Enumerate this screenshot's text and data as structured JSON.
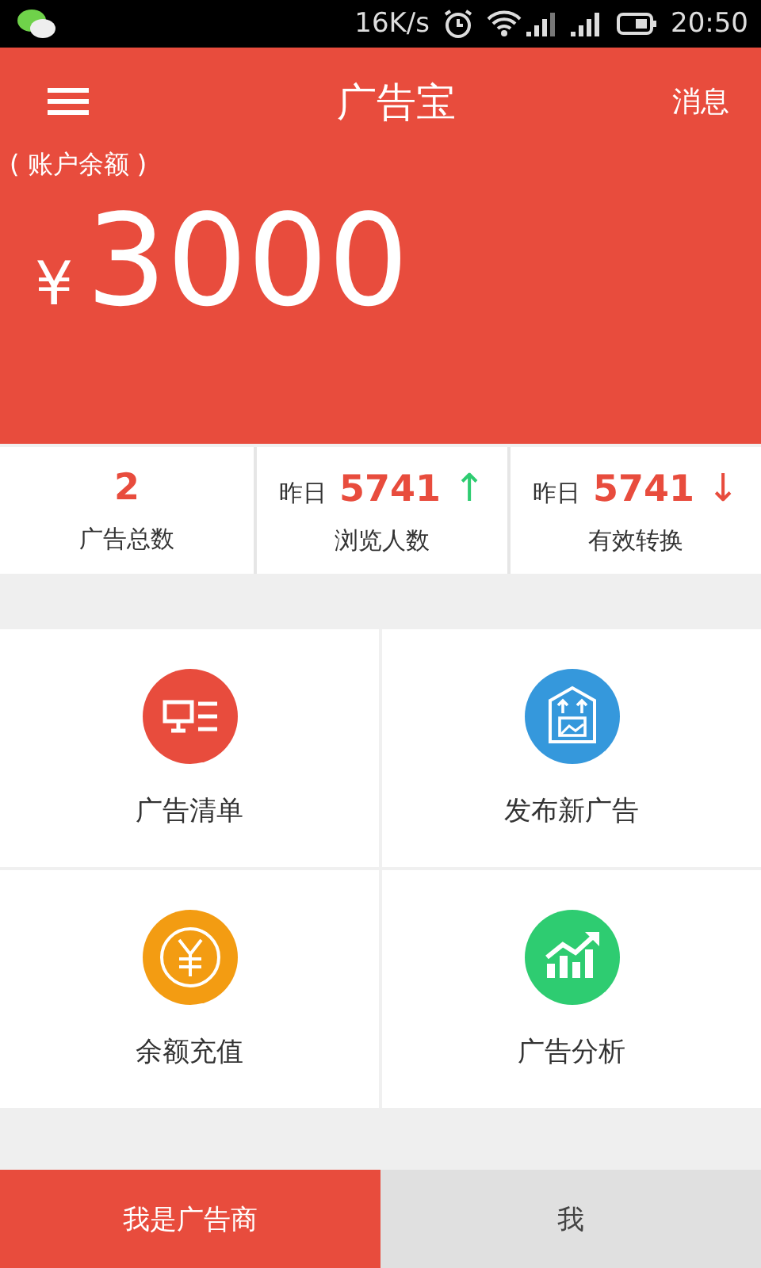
{
  "status_bar": {
    "network_speed": "16K/s",
    "time": "20:50"
  },
  "header": {
    "title": "广告宝",
    "action": "消息"
  },
  "balance": {
    "label": "( 账户余额 )",
    "currency": "¥",
    "amount": "3000"
  },
  "stats": [
    {
      "value": "2",
      "label": "广告总数"
    },
    {
      "kind": "rise",
      "prefix": "昨日",
      "value": "5741",
      "arrow": "↑",
      "label": "浏览人数"
    },
    {
      "kind": "fall",
      "prefix": "昨日",
      "value": "5741",
      "arrow": "↓",
      "label": "有效转换"
    }
  ],
  "menu": [
    {
      "label": "广告清单",
      "color": "#e84c3d"
    },
    {
      "label": "发布新广告",
      "color": "#3598dc"
    },
    {
      "label": "余额充值",
      "color": "#f39c12"
    },
    {
      "label": "广告分析",
      "color": "#2ecc71"
    }
  ],
  "tabs": [
    {
      "label": "我是广告商",
      "selected": true
    },
    {
      "label": "我",
      "selected": false
    }
  ]
}
